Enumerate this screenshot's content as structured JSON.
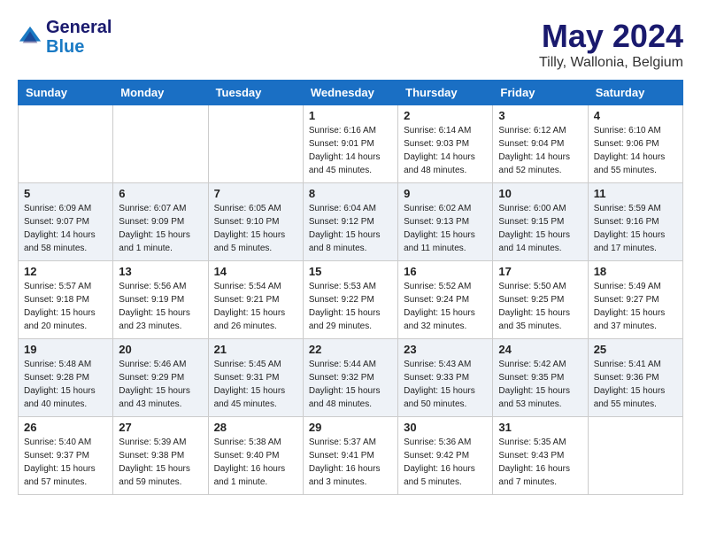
{
  "header": {
    "logo_line1": "General",
    "logo_line2": "Blue",
    "month_year": "May 2024",
    "location": "Tilly, Wallonia, Belgium"
  },
  "weekdays": [
    "Sunday",
    "Monday",
    "Tuesday",
    "Wednesday",
    "Thursday",
    "Friday",
    "Saturday"
  ],
  "weeks": [
    [
      {
        "day": "",
        "info": ""
      },
      {
        "day": "",
        "info": ""
      },
      {
        "day": "",
        "info": ""
      },
      {
        "day": "1",
        "info": "Sunrise: 6:16 AM\nSunset: 9:01 PM\nDaylight: 14 hours\nand 45 minutes."
      },
      {
        "day": "2",
        "info": "Sunrise: 6:14 AM\nSunset: 9:03 PM\nDaylight: 14 hours\nand 48 minutes."
      },
      {
        "day": "3",
        "info": "Sunrise: 6:12 AM\nSunset: 9:04 PM\nDaylight: 14 hours\nand 52 minutes."
      },
      {
        "day": "4",
        "info": "Sunrise: 6:10 AM\nSunset: 9:06 PM\nDaylight: 14 hours\nand 55 minutes."
      }
    ],
    [
      {
        "day": "5",
        "info": "Sunrise: 6:09 AM\nSunset: 9:07 PM\nDaylight: 14 hours\nand 58 minutes."
      },
      {
        "day": "6",
        "info": "Sunrise: 6:07 AM\nSunset: 9:09 PM\nDaylight: 15 hours\nand 1 minute."
      },
      {
        "day": "7",
        "info": "Sunrise: 6:05 AM\nSunset: 9:10 PM\nDaylight: 15 hours\nand 5 minutes."
      },
      {
        "day": "8",
        "info": "Sunrise: 6:04 AM\nSunset: 9:12 PM\nDaylight: 15 hours\nand 8 minutes."
      },
      {
        "day": "9",
        "info": "Sunrise: 6:02 AM\nSunset: 9:13 PM\nDaylight: 15 hours\nand 11 minutes."
      },
      {
        "day": "10",
        "info": "Sunrise: 6:00 AM\nSunset: 9:15 PM\nDaylight: 15 hours\nand 14 minutes."
      },
      {
        "day": "11",
        "info": "Sunrise: 5:59 AM\nSunset: 9:16 PM\nDaylight: 15 hours\nand 17 minutes."
      }
    ],
    [
      {
        "day": "12",
        "info": "Sunrise: 5:57 AM\nSunset: 9:18 PM\nDaylight: 15 hours\nand 20 minutes."
      },
      {
        "day": "13",
        "info": "Sunrise: 5:56 AM\nSunset: 9:19 PM\nDaylight: 15 hours\nand 23 minutes."
      },
      {
        "day": "14",
        "info": "Sunrise: 5:54 AM\nSunset: 9:21 PM\nDaylight: 15 hours\nand 26 minutes."
      },
      {
        "day": "15",
        "info": "Sunrise: 5:53 AM\nSunset: 9:22 PM\nDaylight: 15 hours\nand 29 minutes."
      },
      {
        "day": "16",
        "info": "Sunrise: 5:52 AM\nSunset: 9:24 PM\nDaylight: 15 hours\nand 32 minutes."
      },
      {
        "day": "17",
        "info": "Sunrise: 5:50 AM\nSunset: 9:25 PM\nDaylight: 15 hours\nand 35 minutes."
      },
      {
        "day": "18",
        "info": "Sunrise: 5:49 AM\nSunset: 9:27 PM\nDaylight: 15 hours\nand 37 minutes."
      }
    ],
    [
      {
        "day": "19",
        "info": "Sunrise: 5:48 AM\nSunset: 9:28 PM\nDaylight: 15 hours\nand 40 minutes."
      },
      {
        "day": "20",
        "info": "Sunrise: 5:46 AM\nSunset: 9:29 PM\nDaylight: 15 hours\nand 43 minutes."
      },
      {
        "day": "21",
        "info": "Sunrise: 5:45 AM\nSunset: 9:31 PM\nDaylight: 15 hours\nand 45 minutes."
      },
      {
        "day": "22",
        "info": "Sunrise: 5:44 AM\nSunset: 9:32 PM\nDaylight: 15 hours\nand 48 minutes."
      },
      {
        "day": "23",
        "info": "Sunrise: 5:43 AM\nSunset: 9:33 PM\nDaylight: 15 hours\nand 50 minutes."
      },
      {
        "day": "24",
        "info": "Sunrise: 5:42 AM\nSunset: 9:35 PM\nDaylight: 15 hours\nand 53 minutes."
      },
      {
        "day": "25",
        "info": "Sunrise: 5:41 AM\nSunset: 9:36 PM\nDaylight: 15 hours\nand 55 minutes."
      }
    ],
    [
      {
        "day": "26",
        "info": "Sunrise: 5:40 AM\nSunset: 9:37 PM\nDaylight: 15 hours\nand 57 minutes."
      },
      {
        "day": "27",
        "info": "Sunrise: 5:39 AM\nSunset: 9:38 PM\nDaylight: 15 hours\nand 59 minutes."
      },
      {
        "day": "28",
        "info": "Sunrise: 5:38 AM\nSunset: 9:40 PM\nDaylight: 16 hours\nand 1 minute."
      },
      {
        "day": "29",
        "info": "Sunrise: 5:37 AM\nSunset: 9:41 PM\nDaylight: 16 hours\nand 3 minutes."
      },
      {
        "day": "30",
        "info": "Sunrise: 5:36 AM\nSunset: 9:42 PM\nDaylight: 16 hours\nand 5 minutes."
      },
      {
        "day": "31",
        "info": "Sunrise: 5:35 AM\nSunset: 9:43 PM\nDaylight: 16 hours\nand 7 minutes."
      },
      {
        "day": "",
        "info": ""
      }
    ]
  ]
}
